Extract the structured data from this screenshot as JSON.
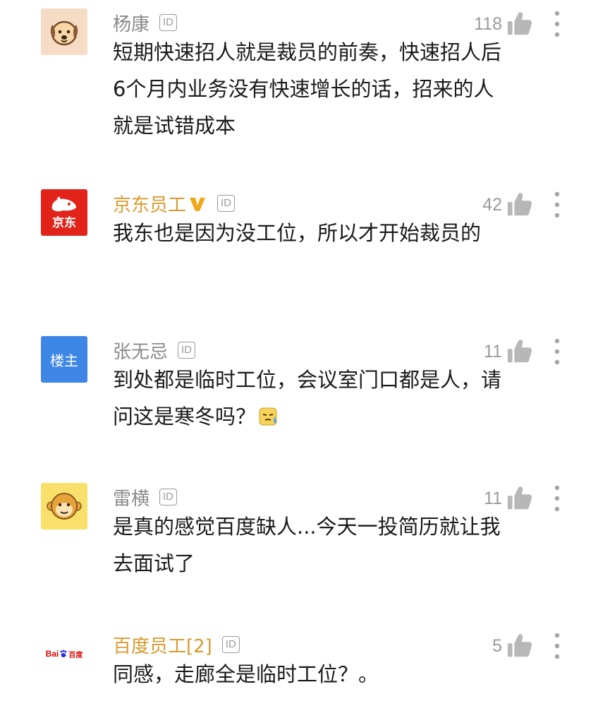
{
  "comments": [
    {
      "user": "杨康",
      "official": false,
      "avatar": "dog-avatar",
      "id_badge": "ID",
      "likes": "118",
      "text": "短期快速招人就是裁员的前奏，快速招人后6个月内业务没有快速增长的话，招来的人就是试错成本"
    },
    {
      "user": "京东员工",
      "official": true,
      "verified_icon": "v-badge-icon",
      "avatar": "jd-logo-avatar",
      "avatar_text": "京东",
      "id_badge": "ID",
      "likes": "42",
      "text": "我东也是因为没工位，所以才开始裁员的"
    },
    {
      "user": "张无忌",
      "official": false,
      "avatar": "host-avatar",
      "avatar_text": "楼主",
      "id_badge": "ID",
      "likes": "11",
      "text": "到处都是临时工位，会议室门口都是人，请问这是寒冬吗？",
      "emoji": "cold-sweat-emoji"
    },
    {
      "user": "雷横",
      "official": false,
      "avatar": "monkey-avatar",
      "id_badge": "ID",
      "likes": "11",
      "text": "是真的感觉百度缺人...今天一投简历就让我去面试了"
    },
    {
      "user": "百度员工[2]",
      "official": true,
      "avatar": "baidu-logo-avatar",
      "avatar_text": "Bai",
      "avatar_text2": "百度",
      "id_badge": "ID",
      "likes": "5",
      "text": "同感，走廊全是临时工位？。"
    }
  ],
  "colors": {
    "official_name": "#d89a2e",
    "normal_name": "#8a8a8a",
    "jd_red": "#e2231a",
    "host_blue": "#3d86e6",
    "baidu_blue": "#2932e1",
    "baidu_red": "#e10602"
  },
  "icons": {
    "like": "thumbs-up-icon",
    "more": "more-vertical-icon"
  }
}
